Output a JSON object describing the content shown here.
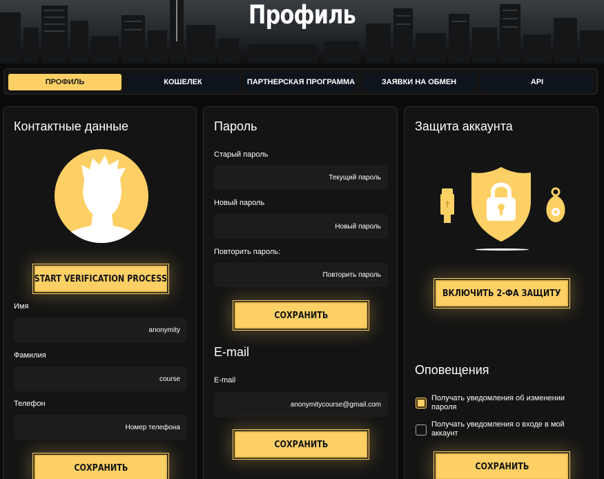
{
  "page": {
    "title": "Профиль"
  },
  "tabs": [
    {
      "label": "ПРОФИЛЬ",
      "active": true
    },
    {
      "label": "КОШЕЛЕК",
      "active": false
    },
    {
      "label": "ПАРТНЕРСКАЯ ПРОГРАММА",
      "active": false
    },
    {
      "label": "ЗАЯВКИ НА ОБМЕН",
      "active": false
    },
    {
      "label": "API",
      "active": false
    }
  ],
  "contacts": {
    "title": "Контактные данные",
    "verify_button": "START VERIFICATION PROCESS",
    "first_name": {
      "label": "Имя",
      "value": "anonymity"
    },
    "last_name": {
      "label": "Фамилия",
      "value": "course"
    },
    "phone": {
      "label": "Телефон",
      "placeholder": "Номер телефона"
    },
    "save_button": "СОХРАНИТЬ"
  },
  "password": {
    "title": "Пароль",
    "old": {
      "label": "Старый пароль",
      "placeholder": "Текущий пароль"
    },
    "new": {
      "label": "Новый пароль",
      "placeholder": "Новый пароль"
    },
    "repeat": {
      "label": "Повторить пароль:",
      "placeholder": "Повторить пароль"
    },
    "save_button": "СОХРАНИТЬ"
  },
  "email": {
    "title": "E-mail",
    "label": "E-mail",
    "value": "anonymitycourse@gmail.com",
    "save_button": "СОХРАНИТЬ"
  },
  "security": {
    "title": "Защита аккаунта",
    "enable_2fa_button": "ВКЛЮЧИТЬ 2-ФА ЗАЩИТУ"
  },
  "notifications": {
    "title": "Оповещения",
    "items": [
      {
        "label": "Получать уведомления об изменении пароля",
        "checked": true
      },
      {
        "label": "Получать уведомления о входе в мой аккаунт",
        "checked": false
      }
    ],
    "save_button": "СОХРАНИТЬ"
  },
  "colors": {
    "accent": "#fdd065",
    "background": "#0b0b0b",
    "panel": "#141414",
    "input": "#1c1c1c"
  },
  "icons": [
    "avatar-silhouette-icon",
    "shield-lock-icon",
    "usb-key-icon",
    "key-fob-icon"
  ]
}
